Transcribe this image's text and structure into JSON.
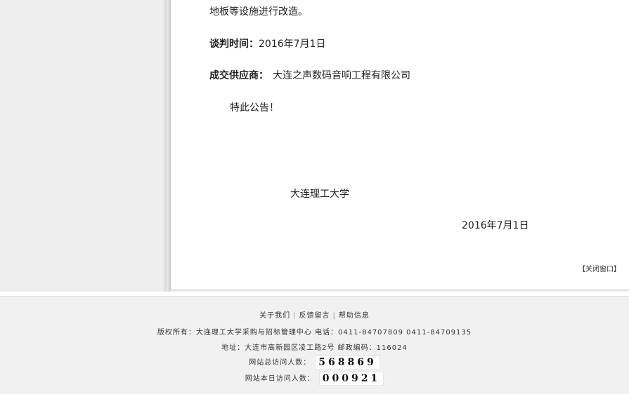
{
  "article": {
    "continued_text": "地板等设施进行改造。",
    "negotiation_date_label": "谈判时间：",
    "negotiation_date_value": "2016年7月1日",
    "supplier_label": "成交供应商：",
    "supplier_value": "大连之声数码音响工程有限公司",
    "closing_note": "特此公告！",
    "signature_org": "大连理工大学",
    "signature_date": "2016年7月1日",
    "close_window": "【关闭窗口】"
  },
  "footer": {
    "links": [
      "关于我们",
      "反馈留言",
      "帮助信息"
    ],
    "copyright": "版权所有：大连理工大学采购与招标管理中心   电话：0411-84707809  0411-84709135",
    "address": "地址：大连市高新园区凌工路2号  邮政编码：116024",
    "total_visits_label": "网站总访问人数：",
    "total_visits_value": "568869",
    "today_visits_label": "网站本日访问人数：",
    "today_visits_value": "000921"
  },
  "colors": {
    "gutter": "#ededed",
    "footer_bg": "#f1f1f1",
    "text": "#222222"
  }
}
